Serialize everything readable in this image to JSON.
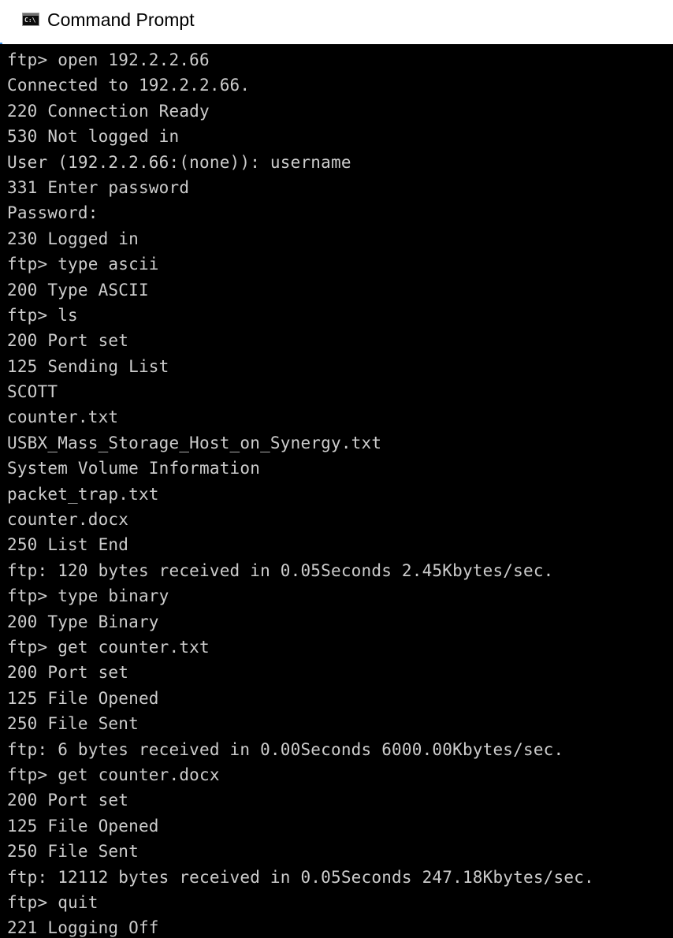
{
  "window": {
    "title": "Command Prompt",
    "icon": "command-prompt-icon",
    "icon_text": "C:\\"
  },
  "colors": {
    "console_background": "#000000",
    "console_text": "#cccccc",
    "titlebar_background": "#ffffff"
  },
  "console": {
    "lines": [
      "ftp> open 192.2.2.66",
      "Connected to 192.2.2.66.",
      "220 Connection Ready",
      "530 Not logged in",
      "User (192.2.2.66:(none)): username",
      "331 Enter password",
      "Password:",
      "230 Logged in",
      "ftp> type ascii",
      "200 Type ASCII",
      "ftp> ls",
      "200 Port set",
      "125 Sending List",
      "SCOTT",
      "counter.txt",
      "USBX_Mass_Storage_Host_on_Synergy.txt",
      "System Volume Information",
      "packet_trap.txt",
      "counter.docx",
      "250 List End",
      "ftp: 120 bytes received in 0.05Seconds 2.45Kbytes/sec.",
      "ftp> type binary",
      "200 Type Binary",
      "ftp> get counter.txt",
      "200 Port set",
      "125 File Opened",
      "250 File Sent",
      "ftp: 6 bytes received in 0.00Seconds 6000.00Kbytes/sec.",
      "ftp> get counter.docx",
      "200 Port set",
      "125 File Opened",
      "250 File Sent",
      "ftp: 12112 bytes received in 0.05Seconds 247.18Kbytes/sec.",
      "ftp> quit",
      "221 Logging Off"
    ]
  }
}
